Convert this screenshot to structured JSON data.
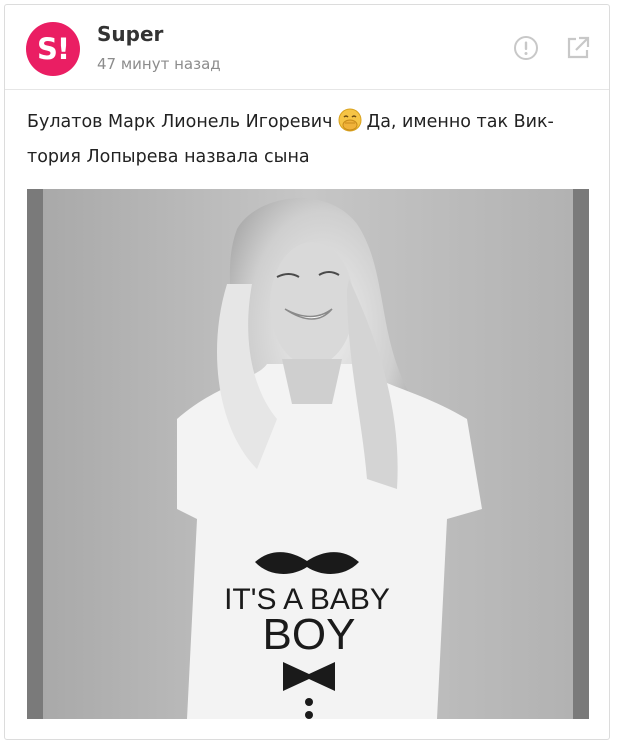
{
  "source": {
    "avatar_text": "S!",
    "name": "Super",
    "time": "47 минут назад",
    "brand_color": "#ea1e63"
  },
  "actions": {
    "report_icon": "exclamation-circle-icon",
    "open_icon": "open-external-icon"
  },
  "post": {
    "text_before_emoji": "Булатов Марк Лионель Игоревич",
    "emoji": "face-with-hand-over-mouth-emoji",
    "text_after_emoji": "Да, именно так Вик-тория Лопырева назвала сына"
  },
  "photo": {
    "shirt_line1": "IT'S A BABY",
    "shirt_line2": "BOY"
  }
}
